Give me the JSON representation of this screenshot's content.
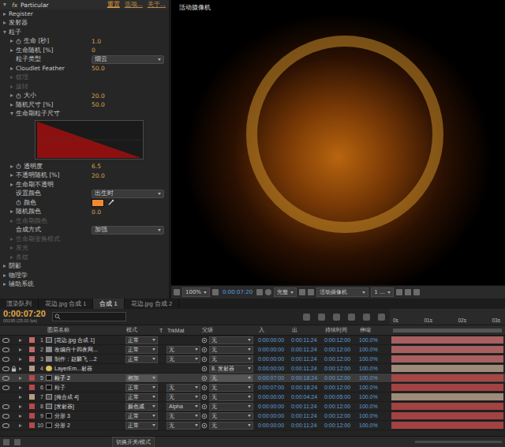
{
  "effect_controls": {
    "fx": "fx",
    "title": "Particular",
    "actions": [
      {
        "label": "重置",
        "highlight": true
      },
      {
        "label": "选项...",
        "highlight": false
      },
      {
        "label": "关于...",
        "highlight": false
      }
    ],
    "rows": [
      {
        "kind": "group",
        "label": "Register",
        "depth": 0,
        "expandable": true,
        "expanded": false,
        "disabled": false,
        "stopwatch": false
      },
      {
        "kind": "group",
        "label": "发射器",
        "depth": 0,
        "expandable": true,
        "expanded": false,
        "disabled": false,
        "stopwatch": false
      },
      {
        "kind": "group",
        "label": "粒子",
        "depth": 0,
        "expandable": true,
        "expanded": true,
        "disabled": false,
        "stopwatch": false
      },
      {
        "kind": "value",
        "label": "生命 [秒]",
        "depth": 1,
        "expandable": true,
        "expanded": false,
        "disabled": false,
        "stopwatch": true,
        "value": "1.0"
      },
      {
        "kind": "value",
        "label": "生命随机 [%]",
        "depth": 1,
        "expandable": true,
        "expanded": false,
        "disabled": false,
        "stopwatch": false,
        "value": "0"
      },
      {
        "kind": "dropdown",
        "label": "粒子类型",
        "depth": 1,
        "expandable": false,
        "expanded": false,
        "disabled": false,
        "stopwatch": false,
        "value": "烟云"
      },
      {
        "kind": "value",
        "label": "Cloudlet Feather",
        "depth": 1,
        "expandable": true,
        "expanded": false,
        "disabled": false,
        "stopwatch": false,
        "value": "50.0"
      },
      {
        "kind": "group",
        "label": "纹理",
        "depth": 1,
        "expandable": true,
        "expanded": false,
        "disabled": true,
        "stopwatch": false
      },
      {
        "kind": "group",
        "label": "旋转",
        "depth": 1,
        "expandable": true,
        "expanded": false,
        "disabled": true,
        "stopwatch": false
      },
      {
        "kind": "value",
        "label": "大小",
        "depth": 1,
        "expandable": true,
        "expanded": false,
        "disabled": false,
        "stopwatch": true,
        "value": "20.0"
      },
      {
        "kind": "value",
        "label": "随机尺寸 [%]",
        "depth": 1,
        "expandable": true,
        "expanded": false,
        "disabled": false,
        "stopwatch": false,
        "value": "50.0"
      },
      {
        "kind": "graph",
        "label": "生命期粒子尺寸",
        "depth": 1,
        "expandable": true,
        "expanded": true,
        "disabled": false,
        "stopwatch": false,
        "curve": [
          1,
          0
        ]
      },
      {
        "kind": "value",
        "label": "透明度",
        "depth": 1,
        "expandable": true,
        "expanded": false,
        "disabled": false,
        "stopwatch": true,
        "value": "6.5"
      },
      {
        "kind": "value",
        "label": "不透明随机 [%]",
        "depth": 1,
        "expandable": true,
        "expanded": false,
        "disabled": false,
        "stopwatch": false,
        "value": "20.0"
      },
      {
        "kind": "group",
        "label": "生命期不透明",
        "depth": 1,
        "expandable": true,
        "expanded": false,
        "disabled": false,
        "stopwatch": false
      },
      {
        "kind": "dropdown",
        "label": "设置颜色",
        "depth": 1,
        "expandable": false,
        "expanded": false,
        "disabled": false,
        "stopwatch": false,
        "value": "出生时"
      },
      {
        "kind": "color",
        "label": "颜色",
        "depth": 1,
        "expandable": false,
        "expanded": false,
        "disabled": false,
        "stopwatch": true,
        "color": "#f08a30"
      },
      {
        "kind": "value",
        "label": "随机颜色",
        "depth": 1,
        "expandable": true,
        "expanded": false,
        "disabled": false,
        "stopwatch": false,
        "value": "0.0"
      },
      {
        "kind": "group",
        "label": "生命期颜色",
        "depth": 1,
        "expandable": true,
        "expanded": false,
        "disabled": true,
        "stopwatch": false
      },
      {
        "kind": "dropdown",
        "label": "合成方式",
        "depth": 1,
        "expandable": false,
        "expanded": false,
        "disabled": false,
        "stopwatch": false,
        "value": "加强"
      },
      {
        "kind": "group",
        "label": "生命期变换模式",
        "depth": 1,
        "expandable": true,
        "expanded": false,
        "disabled": true,
        "stopwatch": false
      },
      {
        "kind": "group",
        "label": "发光",
        "depth": 1,
        "expandable": true,
        "expanded": false,
        "disabled": true,
        "stopwatch": false
      },
      {
        "kind": "group",
        "label": "条纹",
        "depth": 1,
        "expandable": true,
        "expanded": false,
        "disabled": true,
        "stopwatch": false
      },
      {
        "kind": "group",
        "label": "阴影",
        "depth": 0,
        "expandable": true,
        "expanded": false,
        "disabled": false,
        "stopwatch": false
      },
      {
        "kind": "group",
        "label": "物理学",
        "depth": 0,
        "expandable": true,
        "expanded": false,
        "disabled": false,
        "stopwatch": false
      },
      {
        "kind": "group",
        "label": "辅助系统",
        "depth": 0,
        "expandable": true,
        "expanded": false,
        "disabled": false,
        "stopwatch": false
      }
    ]
  },
  "viewer": {
    "label": "活动摄像机",
    "toolbar": {
      "zoom": "100%",
      "time": "0:00:07:20",
      "resolution": "完整",
      "camera": "活动摄像机",
      "views": "1 ..."
    }
  },
  "timeline": {
    "tabs": [
      {
        "label": "渲染队列",
        "selected": false
      },
      {
        "label": "花边.jpg 合成 1",
        "selected": false
      },
      {
        "label": "合成 1",
        "selected": true
      },
      {
        "label": "花边.jpg 合成 2",
        "selected": false
      }
    ],
    "timecode": "0:00:07:20",
    "frame_info": "00195 (25.00 fps)",
    "ruler": [
      "0s",
      "01s",
      "02s",
      "03s"
    ],
    "columns": [
      "图层名称",
      "模式",
      "T",
      "TrkMat",
      "父级",
      "入",
      "出",
      "持续时间",
      "伸缩"
    ],
    "layers": [
      {
        "num": "1",
        "kind": "comp",
        "name": "[花边.jpg 合成 1]",
        "mode": "正常",
        "trkmat": "",
        "parent": "无",
        "in": "0:00:00:00",
        "out": "0:00:11:24",
        "duration": "0:00:12:00",
        "stretch": "100.0%",
        "color": "#c06a6a",
        "visible": true,
        "locked": false,
        "selected": false,
        "bar_start": 0,
        "bar_end": 1
      },
      {
        "num": "2",
        "kind": "text",
        "name": "改编自十四夜网...",
        "mode": "正常",
        "trkmat": "无",
        "parent": "无",
        "in": "0:00:00:00",
        "out": "0:00:11:24",
        "duration": "0:00:12:00",
        "stretch": "100.0%",
        "color": "#c06a6a",
        "visible": true,
        "locked": false,
        "selected": false,
        "bar_start": 0,
        "bar_end": 1
      },
      {
        "num": "3",
        "kind": "text",
        "name": "制作：赵麟飞 ...2",
        "mode": "正常",
        "trkmat": "无",
        "parent": "无",
        "in": "0:00:00:00",
        "out": "0:00:11:24",
        "duration": "0:00:12:00",
        "stretch": "100.0%",
        "color": "#c06a6a",
        "visible": true,
        "locked": false,
        "selected": false,
        "bar_start": 0,
        "bar_end": 1
      },
      {
        "num": "4",
        "kind": "light",
        "name": "LayerEm...射器",
        "mode": "",
        "trkmat": "",
        "parent": "8. 发射器",
        "in": "0:00:00:00",
        "out": "0:00:11:24",
        "duration": "0:00:12:00",
        "stretch": "100.0%",
        "color": "#b39c86",
        "visible": true,
        "locked": true,
        "selected": false,
        "bar_start": 0,
        "bar_end": 1
      },
      {
        "num": "5",
        "kind": "solid",
        "name": "粒子 2",
        "mode": "相加",
        "trkmat": "",
        "parent": "无",
        "in": "0:00:07:00",
        "out": "0:00:18:24",
        "duration": "0:00:12:00",
        "stretch": "100.0%",
        "color": "#b84848",
        "visible": true,
        "locked": false,
        "selected": true,
        "bar_start": 0,
        "bar_end": 1
      },
      {
        "num": "6",
        "kind": "solid",
        "name": "粒子",
        "mode": "正常",
        "trkmat": "无",
        "parent": "无",
        "in": "0:00:07:00",
        "out": "0:00:18:24",
        "duration": "0:00:12:00",
        "stretch": "100.0%",
        "color": "#b84848",
        "visible": true,
        "locked": false,
        "selected": false,
        "bar_start": 0,
        "bar_end": 1
      },
      {
        "num": "7",
        "kind": "comp",
        "name": "[掩合成 4]",
        "mode": "正常",
        "trkmat": "无",
        "parent": "无",
        "in": "0:00:00:00",
        "out": "0:00:04:24",
        "duration": "0:00:05:00",
        "stretch": "100.0%",
        "color": "#b39c86",
        "visible": false,
        "locked": false,
        "selected": false,
        "bar_start": 0,
        "bar_end": 1
      },
      {
        "num": "8",
        "kind": "comp",
        "name": "[发射器]",
        "mode": "颜色减",
        "trkmat": "Alpha",
        "parent": "无",
        "in": "0:00:00:00",
        "out": "0:00:11:24",
        "duration": "0:00:12:00",
        "stretch": "100.0%",
        "color": "#b84848",
        "visible": true,
        "locked": false,
        "selected": false,
        "bar_start": 0,
        "bar_end": 1
      },
      {
        "num": "9",
        "kind": "solid",
        "name": "分形 3",
        "mode": "正常",
        "trkmat": "无",
        "parent": "无",
        "in": "0:00:00:00",
        "out": "0:00:11:24",
        "duration": "0:00:12:00",
        "stretch": "100.0%",
        "color": "#b84848",
        "visible": true,
        "locked": false,
        "selected": false,
        "bar_start": 0,
        "bar_end": 1
      },
      {
        "num": "10",
        "kind": "solid",
        "name": "分形 2",
        "mode": "正常",
        "trkmat": "无",
        "parent": "无",
        "in": "0:00:00:00",
        "out": "0:00:11:24",
        "duration": "0:00:12:00",
        "stretch": "100.0%",
        "color": "#b84848",
        "visible": true,
        "locked": false,
        "selected": false,
        "bar_start": 0,
        "bar_end": 1
      }
    ],
    "footer": "切换开关/模式"
  }
}
